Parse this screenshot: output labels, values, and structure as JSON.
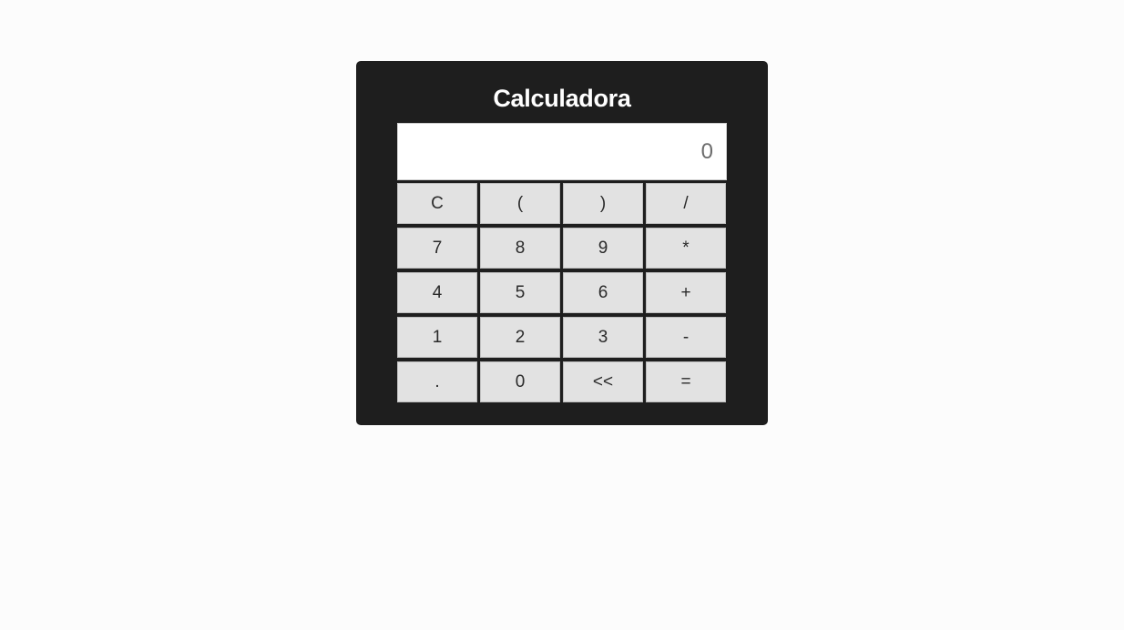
{
  "title": "Calculadora",
  "display": {
    "value": "0"
  },
  "keys": [
    {
      "label": "C",
      "name": "clear-button"
    },
    {
      "label": "(",
      "name": "open-paren-button"
    },
    {
      "label": ")",
      "name": "close-paren-button"
    },
    {
      "label": "/",
      "name": "divide-button"
    },
    {
      "label": "7",
      "name": "digit-7-button"
    },
    {
      "label": "8",
      "name": "digit-8-button"
    },
    {
      "label": "9",
      "name": "digit-9-button"
    },
    {
      "label": "*",
      "name": "multiply-button"
    },
    {
      "label": "4",
      "name": "digit-4-button"
    },
    {
      "label": "5",
      "name": "digit-5-button"
    },
    {
      "label": "6",
      "name": "digit-6-button"
    },
    {
      "label": "+",
      "name": "add-button"
    },
    {
      "label": "1",
      "name": "digit-1-button"
    },
    {
      "label": "2",
      "name": "digit-2-button"
    },
    {
      "label": "3",
      "name": "digit-3-button"
    },
    {
      "label": "-",
      "name": "subtract-button"
    },
    {
      "label": ".",
      "name": "decimal-button"
    },
    {
      "label": "0",
      "name": "digit-0-button"
    },
    {
      "label": "<<",
      "name": "backspace-button"
    },
    {
      "label": "=",
      "name": "equals-button"
    }
  ],
  "colors": {
    "page_background": "#fcfcfc",
    "calculator_body": "#1e1e1e",
    "key_background": "#e2e2e2",
    "display_background": "#ffffff",
    "title_text": "#ffffff"
  }
}
